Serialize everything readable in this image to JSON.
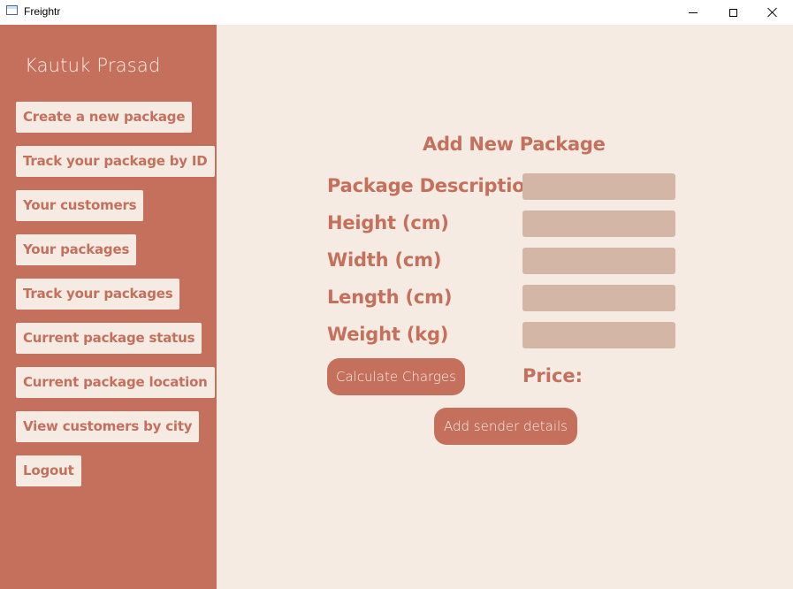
{
  "window": {
    "title": "Freightr",
    "icon": "app-window-icon",
    "controls": [
      "minimize-icon",
      "maximize-icon",
      "close-icon"
    ]
  },
  "sidebar": {
    "user_name": "Kautuk Prasad",
    "background": "#c4705c",
    "items": [
      {
        "label": "Create a new package"
      },
      {
        "label": "Track your package by ID"
      },
      {
        "label": "Your customers"
      },
      {
        "label": "Your packages"
      },
      {
        "label": "Track your packages"
      },
      {
        "label": "Current package status"
      },
      {
        "label": "Current package location"
      },
      {
        "label": "View customers by city"
      },
      {
        "label": "Logout"
      }
    ]
  },
  "form": {
    "title": "Add New Package",
    "fields": [
      {
        "label": "Package Description",
        "value": ""
      },
      {
        "label": "Height (cm)",
        "value": ""
      },
      {
        "label": "Width (cm)",
        "value": ""
      },
      {
        "label": "Length (cm)",
        "value": ""
      },
      {
        "label": "Weight (kg)",
        "value": ""
      }
    ],
    "calculate_label": "Calculate Charges",
    "price_label": "Price:",
    "add_sender_label": "Add sender details"
  },
  "colors": {
    "accent": "#c4705c",
    "panel": "#f6ebe2",
    "input": "#d3b6a6"
  }
}
